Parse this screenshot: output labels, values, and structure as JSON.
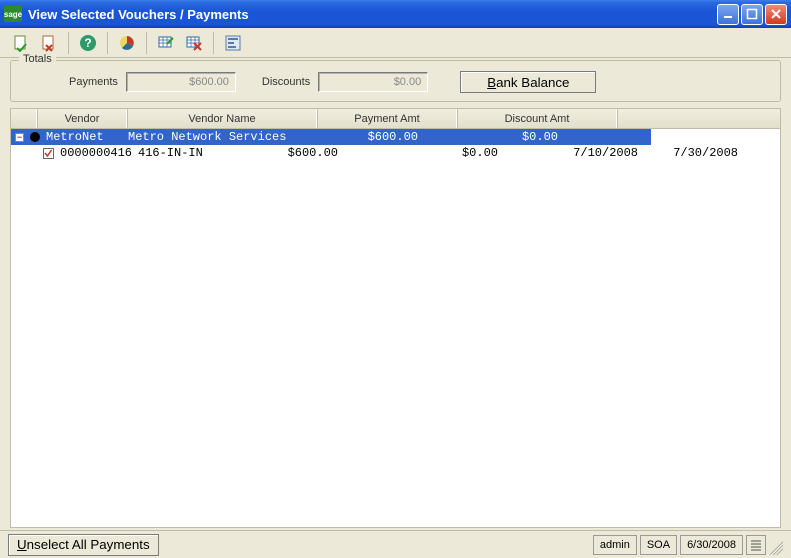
{
  "window": {
    "app_badge": "sage",
    "title": "View Selected Vouchers / Payments"
  },
  "toolbar": {
    "icons": [
      "doc-check-icon",
      "doc-x-icon",
      "help-icon",
      "pie-icon",
      "grid-edit-icon",
      "grid-x-icon",
      "form-icon"
    ]
  },
  "totals": {
    "legend": "Totals",
    "payments_label": "Payments",
    "payments_value": "$600.00",
    "discounts_label": "Discounts",
    "discounts_value": "$0.00",
    "bank_balance_label": "Bank Balance",
    "bank_balance_underline": "B"
  },
  "grid": {
    "headers": {
      "vendor": "Vendor",
      "vendor_name": "Vendor Name",
      "payment_amt": "Payment Amt",
      "discount_amt": "Discount Amt"
    },
    "rows": [
      {
        "type": "vendor",
        "expanded": true,
        "vendor": "MetroNet",
        "vendor_name": "Metro Network Services",
        "payment_amt": "$600.00",
        "discount_amt": "$0.00",
        "selected": true
      },
      {
        "type": "voucher",
        "checked": true,
        "voucher_no": "0000000416",
        "reference": "416-IN-IN",
        "payment_amt": "$600.00",
        "discount_amt": "$0.00",
        "date1": "7/10/2008",
        "date2": "7/30/2008"
      }
    ]
  },
  "bottom": {
    "unselect_label": "Unselect All Payments",
    "unselect_underline": "U",
    "status_user": "admin",
    "status_company": "SOA",
    "status_date": "6/30/2008"
  }
}
